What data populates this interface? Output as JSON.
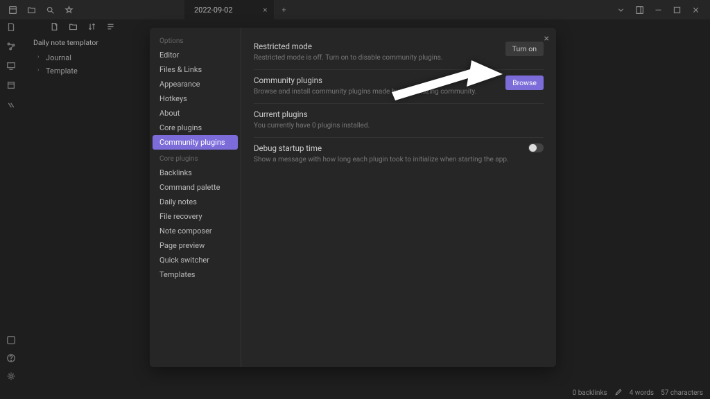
{
  "titlebar": {
    "tab": "2022-09-02"
  },
  "sidebar": {
    "vault_title": "Daily note templator",
    "items": [
      "Journal",
      "Template"
    ]
  },
  "modal": {
    "sections": {
      "options_head": "Options",
      "options": [
        "Editor",
        "Files & Links",
        "Appearance",
        "Hotkeys",
        "About",
        "Core plugins",
        "Community plugins"
      ],
      "core_head": "Core plugins",
      "core": [
        "Backlinks",
        "Command palette",
        "Daily notes",
        "File recovery",
        "Note composer",
        "Page preview",
        "Quick switcher",
        "Templates"
      ]
    },
    "settings": {
      "restricted": {
        "title": "Restricted mode",
        "desc": "Restricted mode is off. Turn on to disable community plugins.",
        "action": "Turn on"
      },
      "community": {
        "title": "Community plugins",
        "desc": "Browse and install community plugins made by our amazing community.",
        "action": "Browse"
      },
      "current": {
        "title": "Current plugins",
        "desc": "You currently have 0 plugins installed."
      },
      "debug": {
        "title": "Debug startup time",
        "desc": "Show a message with how long each plugin took to initialize when starting the app."
      }
    }
  },
  "statusbar": {
    "backlinks": "0 backlinks",
    "words": "4 words",
    "chars": "57 characters"
  }
}
